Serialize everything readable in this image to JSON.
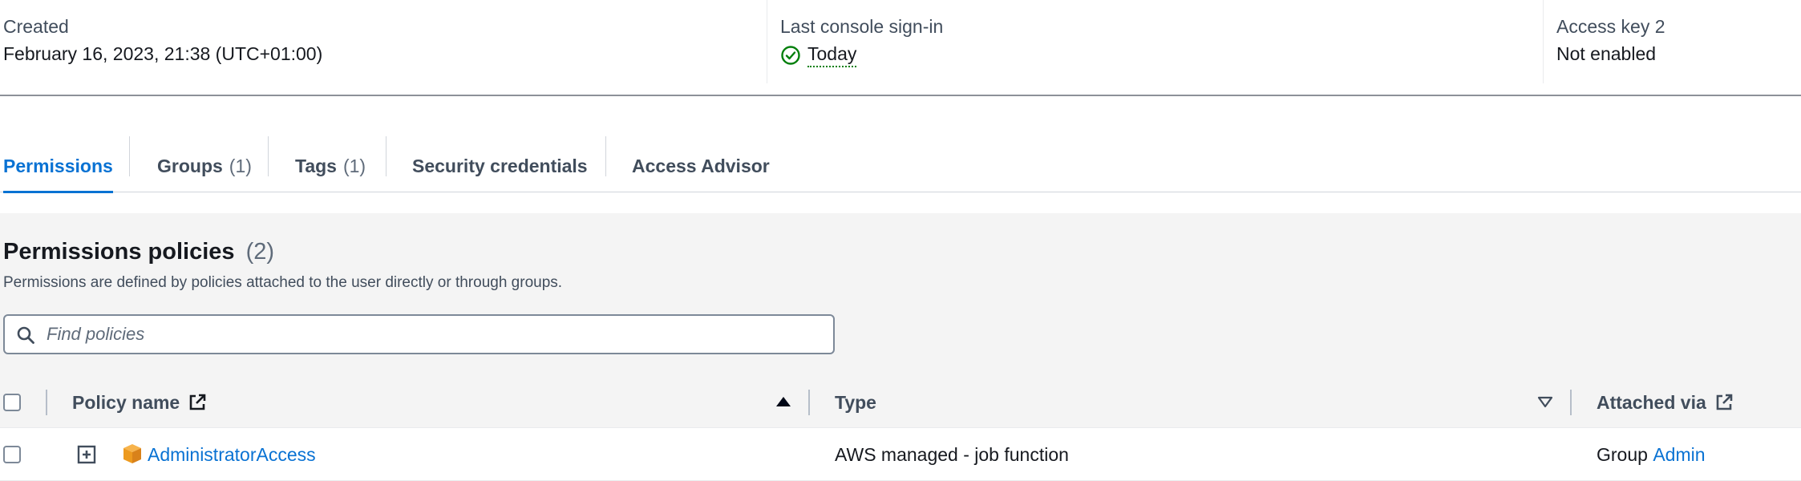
{
  "summary": {
    "created": {
      "label": "Created",
      "value": "February 16, 2023, 21:38 (UTC+01:00)"
    },
    "last_signin": {
      "label": "Last console sign-in",
      "value": "Today",
      "status_color": "#037f0c"
    },
    "access_key_2": {
      "label": "Access key 2",
      "value": "Not enabled"
    }
  },
  "tabs": [
    {
      "label": "Permissions",
      "count": "",
      "active": true
    },
    {
      "label": "Groups",
      "count": "(1)",
      "active": false
    },
    {
      "label": "Tags",
      "count": "(1)",
      "active": false
    },
    {
      "label": "Security credentials",
      "count": "",
      "active": false
    },
    {
      "label": "Access Advisor",
      "count": "",
      "active": false
    }
  ],
  "permissions_policies": {
    "title": "Permissions policies",
    "count": "(2)",
    "description": "Permissions are defined by policies attached to the user directly or through groups.",
    "search_placeholder": "Find policies",
    "search_value": "",
    "columns": {
      "policy_name": "Policy name",
      "type": "Type",
      "attached_via": "Attached via"
    },
    "rows": [
      {
        "policy_name": "AdministratorAccess",
        "type": "AWS managed - job function",
        "attached_via_prefix": "Group",
        "attached_via_link": "Admin"
      }
    ]
  },
  "colors": {
    "accent": "#0972d3",
    "success": "#037f0c",
    "policy_icon": "#ed9a1f"
  },
  "icons": {
    "status": "check-circle-icon",
    "search": "search-icon",
    "external": "external-link-icon",
    "sort_asc": "caret-up-filled-icon",
    "sort_none": "caret-down-outline-icon",
    "expand": "plus-square-icon",
    "policy": "aws-managed-policy-cube-icon"
  }
}
